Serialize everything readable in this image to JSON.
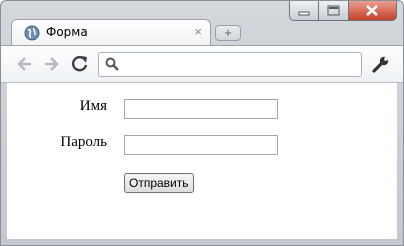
{
  "browser": {
    "tab": {
      "title": "Форма",
      "close_glyph": "×"
    },
    "new_tab_glyph": "+",
    "omnibox": {
      "value": "",
      "placeholder": ""
    }
  },
  "form": {
    "name_label": "Имя",
    "name_value": "",
    "password_label": "Пароль",
    "password_value": "",
    "submit_label": "Отправить"
  }
}
